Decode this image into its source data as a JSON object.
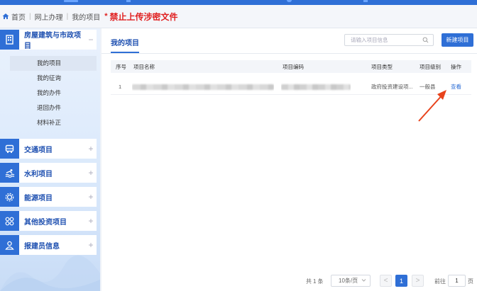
{
  "breadcrumb": {
    "home": "首页",
    "level2": "网上办理",
    "current": "我的项目",
    "warning_star": "*",
    "warning": "禁止上传涉密文件"
  },
  "sidebar": {
    "groups": [
      {
        "label": "房屋建筑与市政项目",
        "icon": "building-icon",
        "toggle": "−"
      },
      {
        "label": "交通项目",
        "icon": "bus-icon",
        "toggle": "+"
      },
      {
        "label": "水利项目",
        "icon": "water-icon",
        "toggle": "+"
      },
      {
        "label": "能源项目",
        "icon": "energy-icon",
        "toggle": "+"
      },
      {
        "label": "其他投资项目",
        "icon": "grid-icon",
        "toggle": "+"
      },
      {
        "label": "报建员信息",
        "icon": "user-icon",
        "toggle": "+"
      }
    ],
    "subitems": [
      "我的项目",
      "我的征询",
      "我的办件",
      "退回办件",
      "材料补正"
    ]
  },
  "main": {
    "title": "我的项目",
    "search_placeholder": "请输入项目信息",
    "new_button": "新建项目",
    "columns": [
      "序号",
      "项目名称",
      "项目编码",
      "项目类型",
      "项目级别",
      "操作"
    ],
    "rows": [
      {
        "index": "1",
        "type": "政府投资建设项...",
        "level": "一般县",
        "action": "查看"
      }
    ]
  },
  "pagination": {
    "total_prefix": "共",
    "total": "1",
    "total_suffix": "条",
    "page_size": "10条/页",
    "prev": "<",
    "current": "1",
    "next": ">",
    "goto_prefix": "前往",
    "goto_value": "1",
    "goto_suffix": "页"
  },
  "colors": {
    "primary": "#2f6fd6",
    "warning": "#e02020",
    "arrow": "#e8431c"
  }
}
